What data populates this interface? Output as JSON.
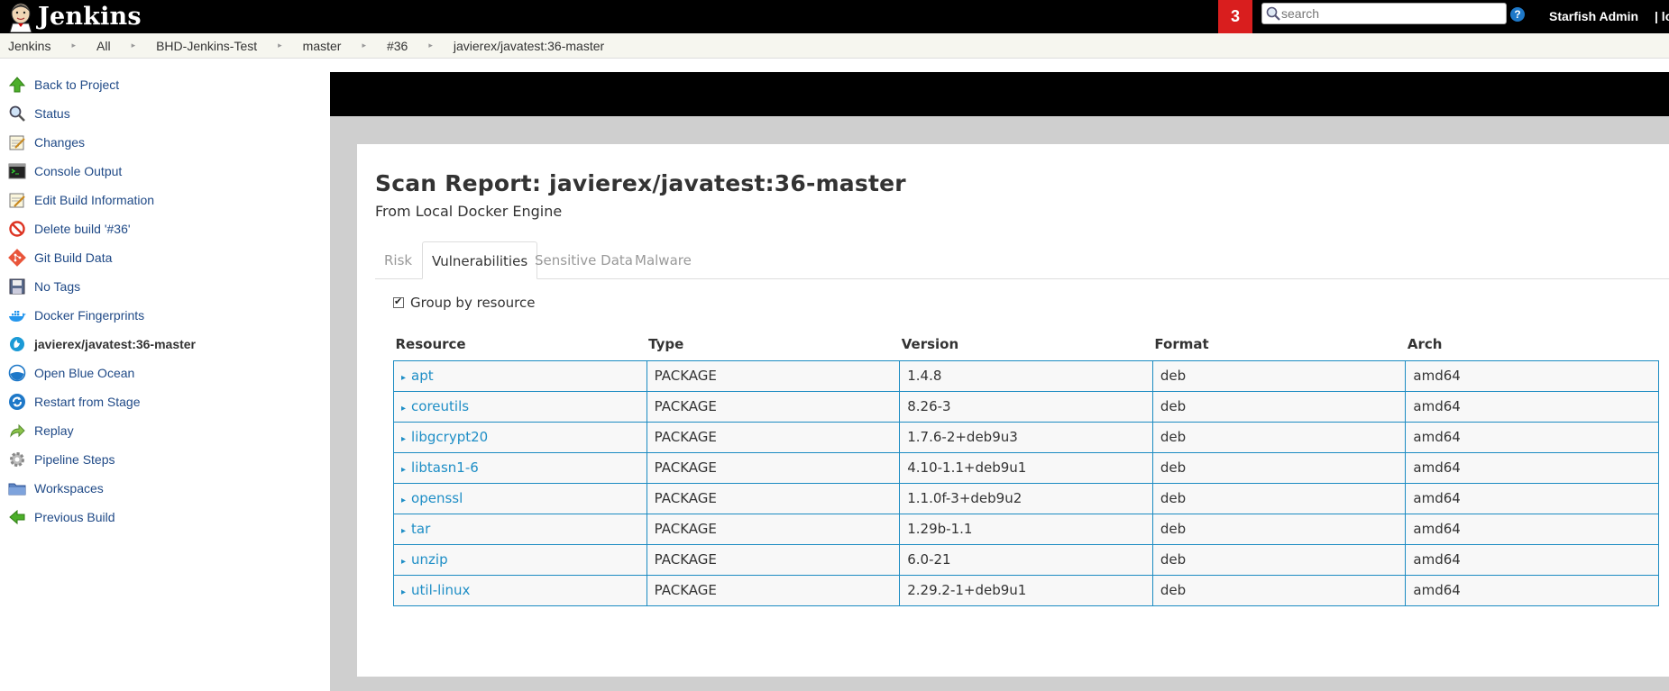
{
  "header": {
    "app_name": "Jenkins",
    "notification_count": "3",
    "search_placeholder": "search",
    "help_label": "?",
    "user_name": "Starfish Admin",
    "logout_partial": "| lo"
  },
  "breadcrumb": [
    "Jenkins",
    "All",
    "BHD-Jenkins-Test",
    "master",
    "#36",
    "javierex/javatest:36-master"
  ],
  "sidebar": {
    "items": [
      {
        "label": "Back to Project",
        "icon": "up-arrow-icon"
      },
      {
        "label": "Status",
        "icon": "magnifier-icon"
      },
      {
        "label": "Changes",
        "icon": "notepad-icon"
      },
      {
        "label": "Console Output",
        "icon": "terminal-icon"
      },
      {
        "label": "Edit Build Information",
        "icon": "notepad-pencil-icon"
      },
      {
        "label": "Delete build '#36'",
        "icon": "no-entry-icon"
      },
      {
        "label": "Git Build Data",
        "icon": "git-icon"
      },
      {
        "label": "No Tags",
        "icon": "floppy-icon"
      },
      {
        "label": "Docker Fingerprints",
        "icon": "docker-icon"
      },
      {
        "label": "javierex/javatest:36-master",
        "icon": "twistlock-icon",
        "active": true
      },
      {
        "label": "Open Blue Ocean",
        "icon": "blue-ocean-icon"
      },
      {
        "label": "Restart from Stage",
        "icon": "restart-icon"
      },
      {
        "label": "Replay",
        "icon": "replay-arrow-icon"
      },
      {
        "label": "Pipeline Steps",
        "icon": "gear-icon"
      },
      {
        "label": "Workspaces",
        "icon": "folder-icon"
      },
      {
        "label": "Previous Build",
        "icon": "left-arrow-icon"
      }
    ]
  },
  "report": {
    "title": "Scan Report: javierex/javatest:36-master",
    "subtitle": "From Local Docker Engine",
    "tabs": [
      "Risk",
      "Vulnerabilities",
      "Sensitive Data",
      "Malware"
    ],
    "active_tab": "Vulnerabilities",
    "group_by_label": "Group by resource",
    "group_by_checked": true,
    "columns": [
      "Resource",
      "Type",
      "Version",
      "Format",
      "Arch"
    ],
    "rows": [
      [
        "apt",
        "PACKAGE",
        "1.4.8",
        "deb",
        "amd64"
      ],
      [
        "coreutils",
        "PACKAGE",
        "8.26-3",
        "deb",
        "amd64"
      ],
      [
        "libgcrypt20",
        "PACKAGE",
        "1.7.6-2+deb9u3",
        "deb",
        "amd64"
      ],
      [
        "libtasn1-6",
        "PACKAGE",
        "4.10-1.1+deb9u1",
        "deb",
        "amd64"
      ],
      [
        "openssl",
        "PACKAGE",
        "1.1.0f-3+deb9u2",
        "deb",
        "amd64"
      ],
      [
        "tar",
        "PACKAGE",
        "1.29b-1.1",
        "deb",
        "amd64"
      ],
      [
        "unzip",
        "PACKAGE",
        "6.0-21",
        "deb",
        "amd64"
      ],
      [
        "util-linux",
        "PACKAGE",
        "2.29.2-1+deb9u1",
        "deb",
        "amd64"
      ]
    ],
    "expand_glyph": "▸"
  },
  "colors": {
    "header_bg": "#000000",
    "notification_bg": "#d91e1e",
    "table_border": "#1b8bc2",
    "resource_link": "#1e8ec6",
    "sidebar_link": "#204a87"
  }
}
